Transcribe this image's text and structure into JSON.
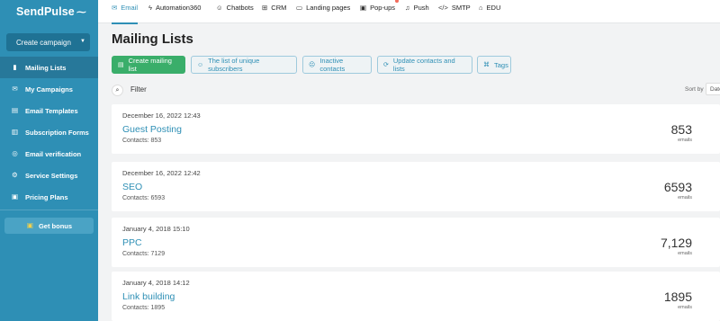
{
  "brand": {
    "name": "SendPulse",
    "mark": "~"
  },
  "sidebar": {
    "create_label": "Create campaign",
    "items": [
      {
        "label": "Mailing Lists",
        "icon": "book-icon",
        "glyph": "▮",
        "active": true
      },
      {
        "label": "My Campaigns",
        "icon": "megaphone-icon",
        "glyph": "✉",
        "active": false
      },
      {
        "label": "Email Templates",
        "icon": "template-icon",
        "glyph": "▤",
        "active": false
      },
      {
        "label": "Subscription Forms",
        "icon": "form-icon",
        "glyph": "▥",
        "active": false
      },
      {
        "label": "Email verification",
        "icon": "verify-icon",
        "glyph": "◎",
        "active": false
      },
      {
        "label": "Service Settings",
        "icon": "gear-icon",
        "glyph": "⚙",
        "active": false
      },
      {
        "label": "Pricing Plans",
        "icon": "pricing-icon",
        "glyph": "▣",
        "active": false
      }
    ],
    "bonus_label": "Get bonus"
  },
  "topnav": {
    "tabs": [
      {
        "label": "Email",
        "icon": "email-icon",
        "glyph": "✉",
        "active": true
      },
      {
        "label": "Automation360",
        "icon": "automation-icon",
        "glyph": "⚡",
        "active": false
      },
      {
        "label": "Chatbots",
        "icon": "chatbot-icon",
        "glyph": "☺",
        "active": false
      },
      {
        "label": "CRM",
        "icon": "crm-icon",
        "glyph": "⊞",
        "active": false
      },
      {
        "label": "Landing pages",
        "icon": "landing-icon",
        "glyph": "▭",
        "active": false
      },
      {
        "label": "Pop-ups",
        "icon": "popup-icon",
        "glyph": "▣",
        "active": false
      },
      {
        "label": "Push",
        "icon": "bell-icon",
        "glyph": "🔔",
        "active": false
      },
      {
        "label": "SMTP",
        "icon": "code-icon",
        "glyph": "</>",
        "active": false
      },
      {
        "label": "EDU",
        "icon": "graduation-icon",
        "glyph": "🎓",
        "active": false
      }
    ]
  },
  "main": {
    "title": "Mailing Lists",
    "actions": {
      "create": "Create mailing list",
      "unique": "The list of unique subscribers",
      "inactive": "Inactive contacts",
      "update": "Update contacts and lists",
      "tags": "Tags"
    },
    "filter_label": "Filter",
    "sort_label": "Sort by",
    "sort_value": "Date"
  },
  "lists": [
    {
      "date": "December 16, 2022 12:43",
      "name": "Guest Posting",
      "contacts": "Contacts: 853",
      "count": "853",
      "unit": "emails"
    },
    {
      "date": "December 16, 2022 12:42",
      "name": "SEO",
      "contacts": "Contacts: 6593",
      "count": "6593",
      "unit": "emails"
    },
    {
      "date": "January 4, 2018 15:10",
      "name": "PPC",
      "contacts": "Contacts: 7129",
      "count": "7,129",
      "unit": "emails"
    },
    {
      "date": "January 4, 2018 14:12",
      "name": "Link building",
      "contacts": "Contacts: 1895",
      "count": "1895",
      "unit": "emails"
    }
  ],
  "colors": {
    "sidebar": "#2e8fb5",
    "accent": "#2e8fb5",
    "primary_button": "#3aae6a",
    "badge": "#f26b5b"
  }
}
